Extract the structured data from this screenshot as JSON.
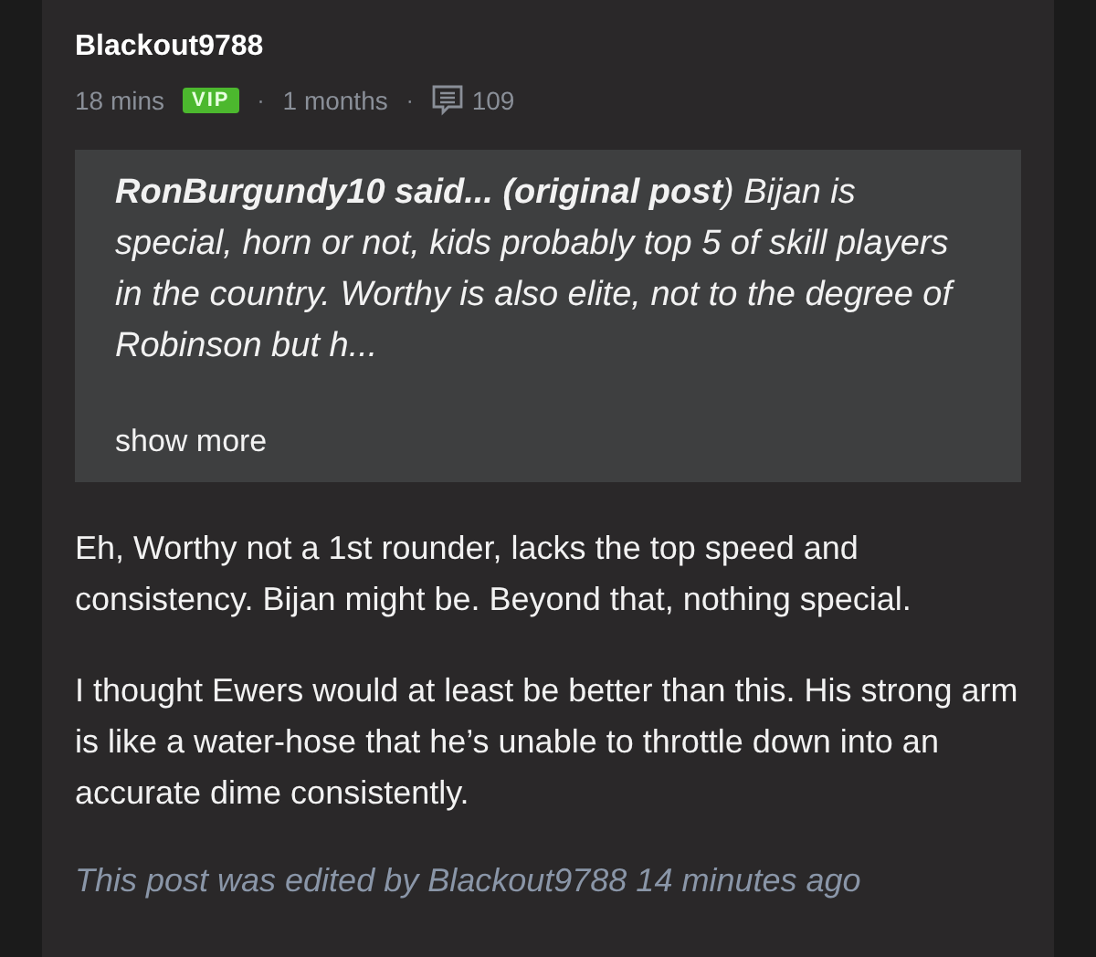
{
  "post": {
    "author": "Blackout9788",
    "time": "18 mins",
    "badge": "VIP",
    "tenure": "1 months",
    "separators": [
      "·",
      "·"
    ],
    "comment_count": "109",
    "quote": {
      "text": "**RonBurgundy10 said... (original post**) Bijan is special, horn or not, kids probably top 5 of skill players in the country. Worthy is also elite, not to the degree of Robinson but h...",
      "show_more": "show more"
    },
    "paragraphs": [
      "Eh, Worthy not a 1st rounder, lacks the top speed and consistency. Bijan might be. Beyond that, nothing special.",
      "I thought Ewers would at least be better than this. His strong arm is like a water-hose that he’s unable to throttle down into an accurate dime consistently."
    ],
    "edit_note": "This post was edited by Blackout9788 14 minutes ago"
  }
}
